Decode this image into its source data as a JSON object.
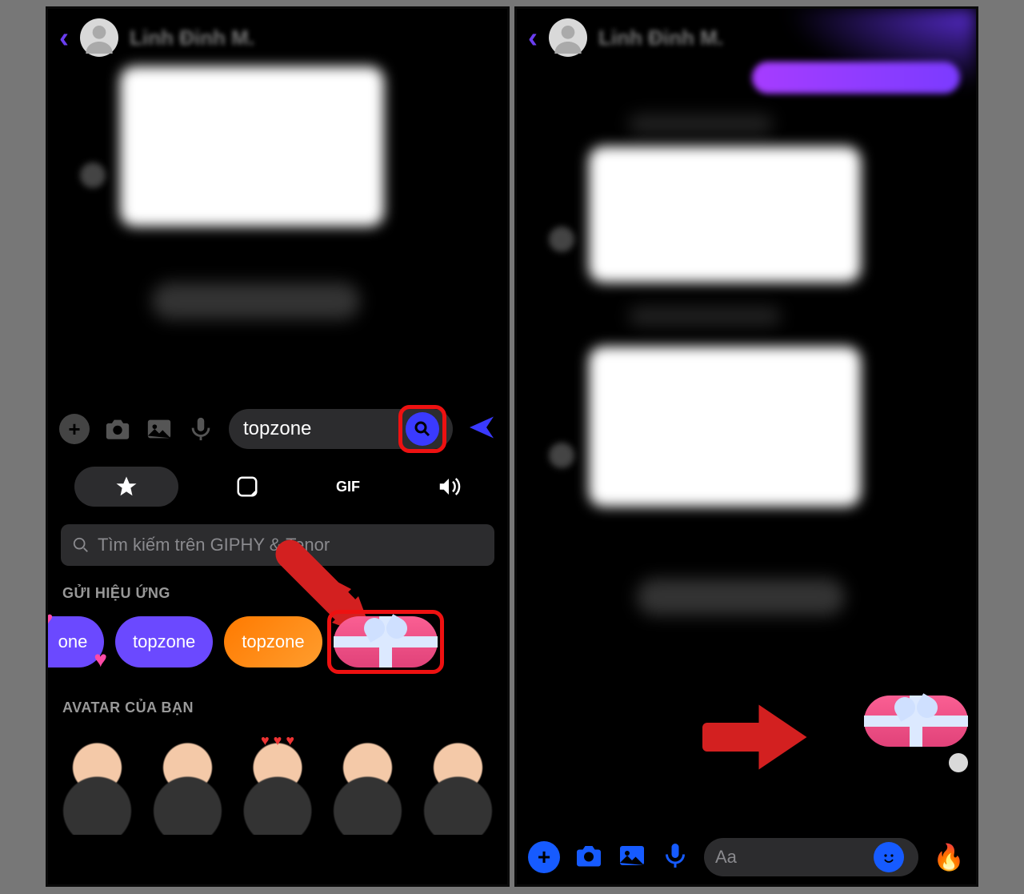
{
  "left": {
    "header": {
      "chat_name": "Linh Đinh M."
    },
    "composer": {
      "input_value": "topzone"
    },
    "tabs": {
      "gif_label": "GIF"
    },
    "gif_search_placeholder": "Tìm kiếm trên GIPHY & Tenor",
    "sections": {
      "effects_label": "GỬI HIỆU ỨNG",
      "avatar_label": "AVATAR CỦA BẠN"
    },
    "effects": {
      "item0": "one",
      "item1": "topzone",
      "item2": "topzone"
    }
  },
  "right": {
    "header": {
      "chat_name": "Linh Đinh M."
    },
    "composer": {
      "placeholder": "Aa"
    }
  }
}
